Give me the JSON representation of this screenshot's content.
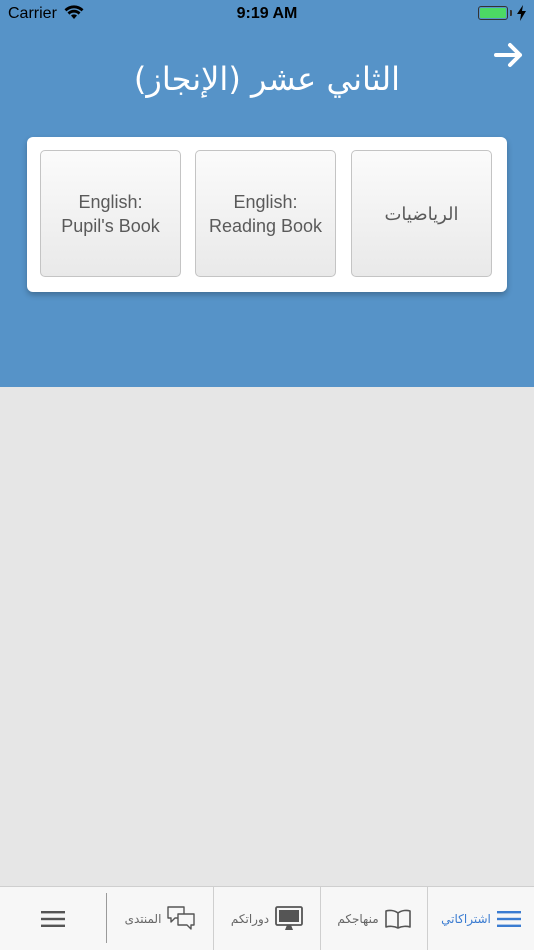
{
  "status": {
    "carrier": "Carrier",
    "time": "9:19 AM",
    "battery_level": 1.0
  },
  "header": {
    "title": "الثاني عشر (الإنجاز)"
  },
  "subjects": [
    {
      "label": "الرياضيات"
    },
    {
      "label": "English:\nReading Book"
    },
    {
      "label": "English:\nPupil's Book"
    }
  ],
  "tabs": [
    {
      "label": "اشتراكاتي",
      "icon": "list-icon",
      "active": true
    },
    {
      "label": "منهاجكم",
      "icon": "open-book-icon"
    },
    {
      "label": "دوراتكم",
      "icon": "monitor-icon"
    },
    {
      "label": "المنتدى",
      "icon": "chat-bubbles-icon"
    },
    {
      "label": "",
      "icon": "menu-icon"
    }
  ],
  "colors": {
    "header_bg": "#5693c8",
    "active_tab": "#3b7cd1",
    "page_bg": "#e6e6e6"
  }
}
